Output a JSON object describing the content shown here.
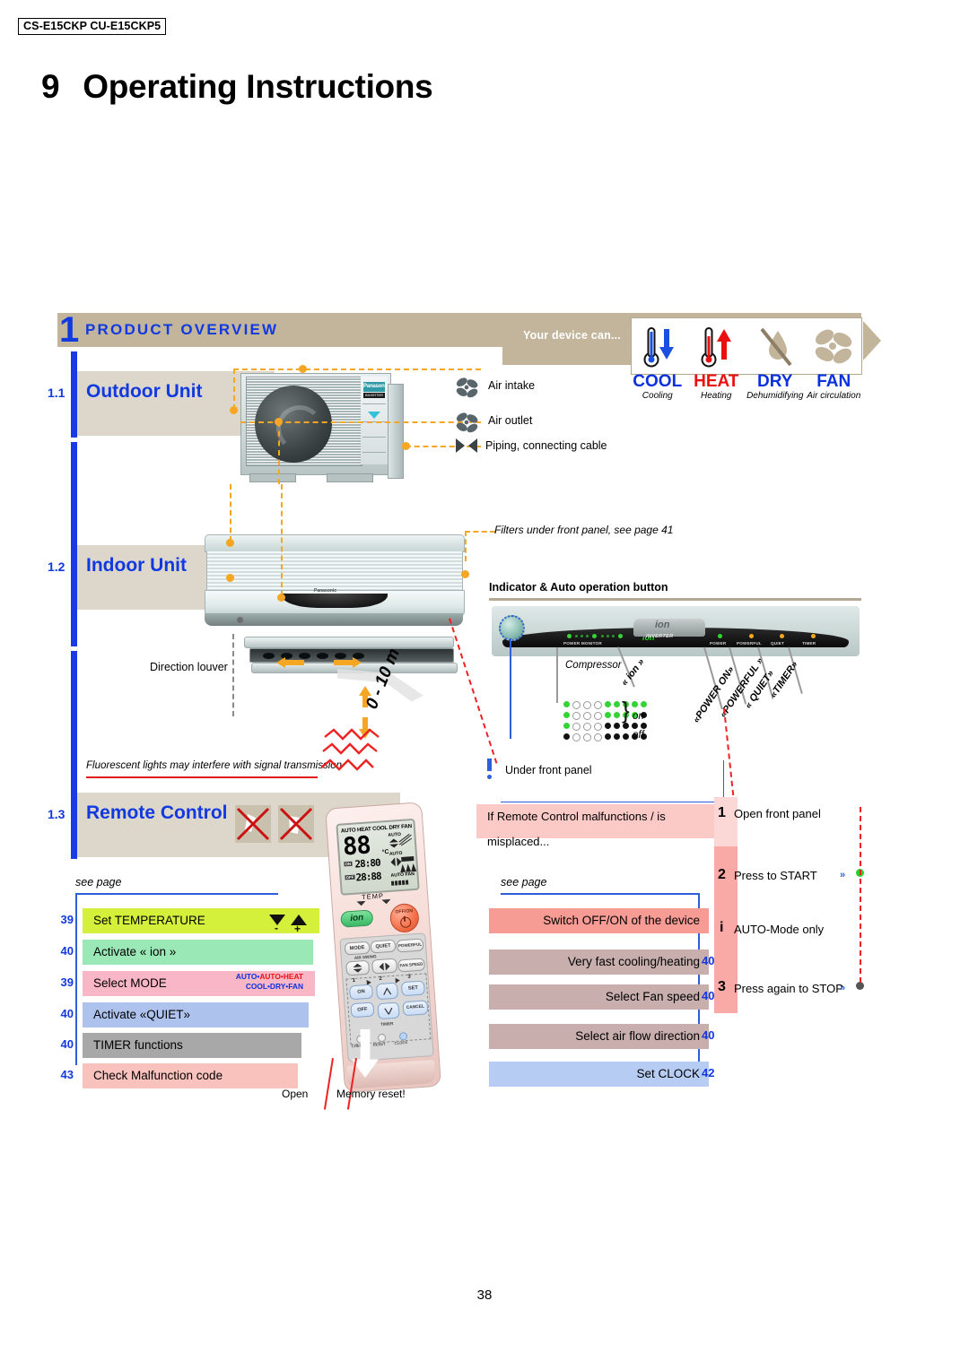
{
  "model_code": "CS-E15CKP CU-E15CKP5",
  "chapter": {
    "number": "9",
    "title": "Operating Instructions"
  },
  "page_number": "38",
  "overview": {
    "section_number": "1",
    "title": "PRODUCT OVERVIEW",
    "device_can_label": "Your device can...",
    "modes": [
      {
        "icon": "thermometer-down-icon",
        "name": "COOL",
        "desc": "Cooling",
        "color": "#0a30e0"
      },
      {
        "icon": "thermometer-up-icon",
        "name": "HEAT",
        "desc": "Heating",
        "color": "#e81010"
      },
      {
        "icon": "droplet-slash-icon",
        "name": "DRY",
        "desc": "Dehumidifying",
        "color": "#0a30e0"
      },
      {
        "icon": "fan-icon",
        "name": "FAN",
        "desc": "Air circulation",
        "color": "#0a30e0"
      }
    ]
  },
  "sections": {
    "outdoor": {
      "number": "1.1",
      "title": "Outdoor Unit"
    },
    "indoor": {
      "number": "1.2",
      "title": "Indoor Unit"
    },
    "remote": {
      "number": "1.3",
      "title": "Remote Control"
    }
  },
  "outdoor_callouts": [
    {
      "icon": "fan-icon",
      "label": "Air intake"
    },
    {
      "icon": "fan-icon",
      "label": "Air outlet"
    },
    {
      "icon": "piping-icon",
      "label": "Piping, connecting cable"
    }
  ],
  "outdoor_unit": {
    "brand": "Panasonic",
    "sub_brand": "INVERTER"
  },
  "indoor_unit": {
    "brand": "Panasonic",
    "louver_label": "Direction louver"
  },
  "filters_note": "Filters under front panel, see page 41",
  "indicator": {
    "title": "Indicator & Auto operation button",
    "panel_labels": [
      {
        "name": "POWER MONITOR"
      },
      {
        "name": "ion"
      },
      {
        "name": "INVERTER"
      },
      {
        "name": "POWER"
      },
      {
        "name": "POWERFUL"
      },
      {
        "name": "QUIET"
      },
      {
        "name": "TIMER"
      }
    ],
    "compressor_label": "Compressor",
    "state_on": "on",
    "state_off": "off",
    "callouts": [
      "« ion »",
      "«POWER ON»",
      "«POWERFUL »",
      "« QUIET»",
      "«TIMER»"
    ]
  },
  "remote_note": "Fluorescent lights may interfere with signal transmission",
  "distance_label": "0 - 10 m",
  "remote_lcd": {
    "modes": "AUTO HEAT COOL DRY FAN",
    "temperature": "88",
    "unit": "°C",
    "timer_on_tag": "ON",
    "timer_on_value": "28:80",
    "timer_off_tag": "OFF",
    "timer_off_value": "28:88",
    "auto_swing": "AUTO",
    "auto_air": "AUTO",
    "fan_label": "AUTO FAN",
    "temp_label": "TEMP"
  },
  "remote_buttons": {
    "ion": "ion",
    "power": "OFF/ON",
    "mode": "MODE",
    "quiet": "QUIET",
    "powerful": "POWERFUL",
    "air_swing": "AIR SWING",
    "fan_speed": "FAN SPEED",
    "on": "ON",
    "off": "OFF",
    "set": "SET",
    "cancel": "CANCEL",
    "timer": "TIMER",
    "steps": [
      "1",
      "2",
      "3"
    ],
    "holes": [
      "CHECK",
      "RESET",
      "CLOCK"
    ]
  },
  "remote_bottom": {
    "open": "Open",
    "memory_reset": "Memory reset!"
  },
  "see_page_label": "see page",
  "functions_left": [
    {
      "page": "39",
      "label": "Set TEMPERATURE",
      "color": "#d4f03a",
      "icon": "up-down-arrows-icon"
    },
    {
      "page": "40",
      "label": "Activate « ion »",
      "color": "#9ae8b6"
    },
    {
      "page": "39",
      "label": "Select MODE",
      "color": "#f9b6c6",
      "tags_line1": "AUTO•HEAT",
      "tags_line2": "COOL•DRY•FAN"
    },
    {
      "page": "40",
      "label": "Activate «QUIET»",
      "color": "#aec2ee"
    },
    {
      "page": "40",
      "label": "TIMER functions",
      "color": "#a8a8a8"
    },
    {
      "page": "43",
      "label": "Check Malfunction code",
      "color": "#f9c2bd"
    }
  ],
  "functions_right": [
    {
      "page": "",
      "label": "Switch OFF/ON of the device",
      "color": "#f79b95"
    },
    {
      "page": "40",
      "label": "Very fast cooling/heating",
      "color": "#c9aeae"
    },
    {
      "page": "40",
      "label": "Select Fan speed",
      "color": "#c9aeae"
    },
    {
      "page": "40",
      "label": "Select air flow direction",
      "color": "#c9aeae"
    },
    {
      "page": "42",
      "label": "Set CLOCK",
      "color": "#b6ccf2"
    }
  ],
  "malfunction": {
    "under_panel": "Under front panel",
    "headline": "If Remote Control malfunctions / is misplaced...",
    "steps": [
      {
        "no": "1",
        "text": "Open front panel",
        "chevron": "",
        "dot": ""
      },
      {
        "no": "2",
        "text": "Press to START",
        "chevron": "»",
        "dot": "#2ecc2e"
      },
      {
        "no": "i",
        "text": "AUTO-Mode only",
        "chevron": "",
        "dot": ""
      },
      {
        "no": "3",
        "text": "Press again to STOP",
        "chevron": "»",
        "dot": "#555555"
      }
    ]
  }
}
